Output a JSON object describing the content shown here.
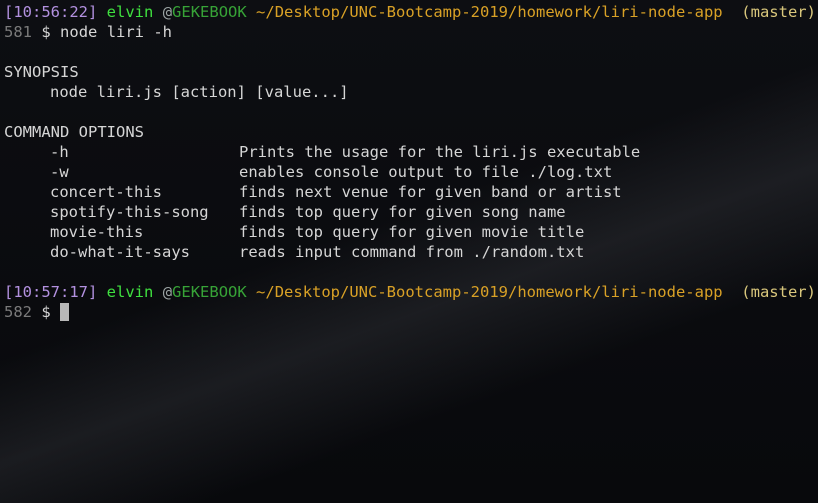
{
  "prompt1": {
    "timestamp": "[10:56:22]",
    "user": "elvin",
    "at": "@",
    "host": "GEKEBOOK",
    "path": "~/Desktop/UNC-Bootcamp-2019/homework/liri-node-app",
    "branch": "(master)"
  },
  "cmd1": {
    "number": "581",
    "symbol": "$",
    "command": "node liri -h"
  },
  "synopsis": {
    "heading": "SYNOPSIS",
    "usage": "node liri.js [action] [value...]"
  },
  "options": {
    "heading": "COMMAND OPTIONS",
    "items": [
      {
        "flag": "-h",
        "desc": "Prints the usage for the liri.js executable"
      },
      {
        "flag": "-w",
        "desc": "enables console output to file ./log.txt"
      },
      {
        "flag": "concert-this",
        "desc": "finds next venue for given band or artist"
      },
      {
        "flag": "spotify-this-song",
        "desc": "finds top query for given song name"
      },
      {
        "flag": "movie-this",
        "desc": "finds top query for given movie title"
      },
      {
        "flag": "do-what-it-says",
        "desc": "reads input command from ./random.txt"
      }
    ]
  },
  "prompt2": {
    "timestamp": "[10:57:17]",
    "user": "elvin",
    "at": "@",
    "host": "GEKEBOOK",
    "path": "~/Desktop/UNC-Bootcamp-2019/homework/liri-node-app",
    "branch": "(master)"
  },
  "cmd2": {
    "number": "582",
    "symbol": "$"
  }
}
